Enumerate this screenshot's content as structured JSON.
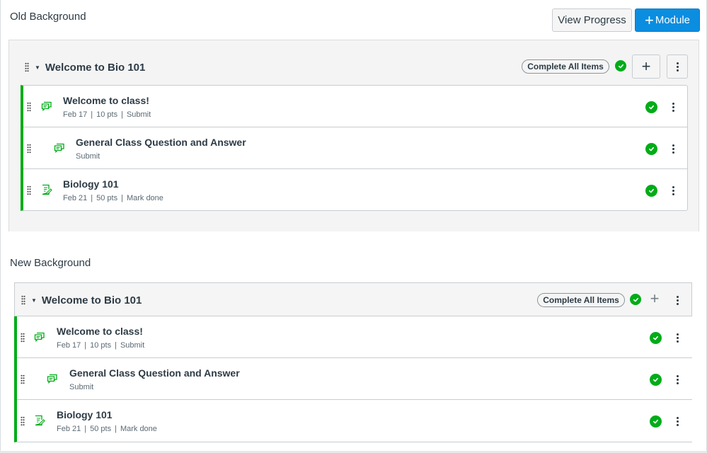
{
  "page": {
    "sections": {
      "old": {
        "label": "Old Background"
      },
      "new": {
        "label": "New Background"
      }
    }
  },
  "toolbar": {
    "view_progress_label": "View Progress",
    "add_module_label": "Module",
    "add_module_icon": "+"
  },
  "colors": {
    "accent": "#0b8de0",
    "success": "#00ac18",
    "old_background": "#f4f4f4",
    "new_background": "#ffffff",
    "new_header_background": "#f5f5f5"
  },
  "modules": [
    {
      "variant": "old",
      "title": "Welcome to Bio 101",
      "complete_all_label": "Complete All Items",
      "completed": true,
      "items": [
        {
          "icon": "discussion-icon",
          "title": "Welcome to class!",
          "meta": [
            "Feb 17",
            "10 pts",
            "Submit"
          ],
          "indented": false,
          "completed": true
        },
        {
          "icon": "discussion-icon",
          "title": "General Class Question and Answer",
          "meta": [
            "Submit"
          ],
          "indented": true,
          "completed": true
        },
        {
          "icon": "assignment-icon",
          "title": "Biology 101",
          "meta": [
            "Feb 21",
            "50 pts",
            "Mark done"
          ],
          "indented": false,
          "completed": true
        }
      ]
    },
    {
      "variant": "new",
      "title": "Welcome to Bio 101",
      "complete_all_label": "Complete All Items",
      "completed": true,
      "items": [
        {
          "icon": "discussion-icon",
          "title": "Welcome to class!",
          "meta": [
            "Feb 17",
            "10 pts",
            "Submit"
          ],
          "indented": false,
          "completed": true
        },
        {
          "icon": "discussion-icon",
          "title": "General Class Question and Answer",
          "meta": [
            "Submit"
          ],
          "indented": true,
          "completed": true
        },
        {
          "icon": "assignment-icon",
          "title": "Biology 101",
          "meta": [
            "Feb 21",
            "50 pts",
            "Mark done"
          ],
          "indented": false,
          "completed": true
        }
      ]
    }
  ]
}
